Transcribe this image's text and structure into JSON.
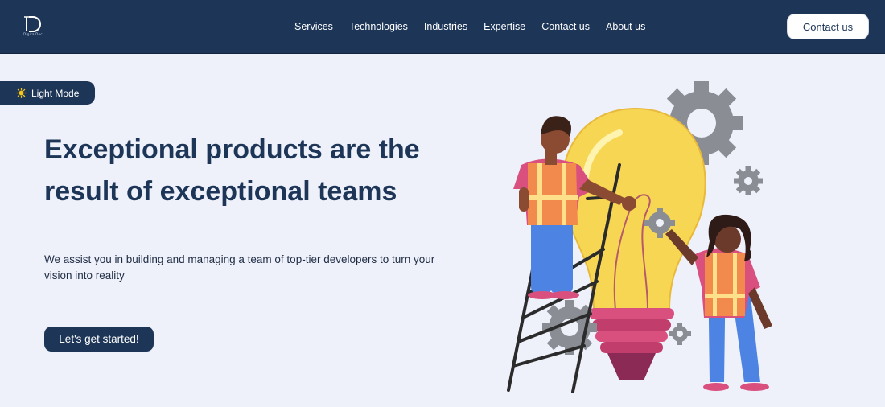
{
  "brand": {
    "logo_text": "DigitalDoc"
  },
  "nav": {
    "links": [
      "Services",
      "Technologies",
      "Industries",
      "Expertise",
      "Contact us",
      "About us"
    ],
    "cta_label": "Contact us"
  },
  "mode_toggle": {
    "label": "Light Mode",
    "icon": "sun-icon"
  },
  "hero": {
    "title": "Exceptional products are the result of exceptional teams",
    "subtitle": "We assist you in building and managing a team of top-tier developers to turn your vision into reality",
    "cta_label": "Let's get started!"
  },
  "colors": {
    "navy": "#1d3557",
    "background": "#eef1fa",
    "bulb": "#f7d654",
    "vest": "#f28a4d",
    "shirt": "#d9507f",
    "jeans": "#4d84e3",
    "gear": "#8a8d93"
  }
}
